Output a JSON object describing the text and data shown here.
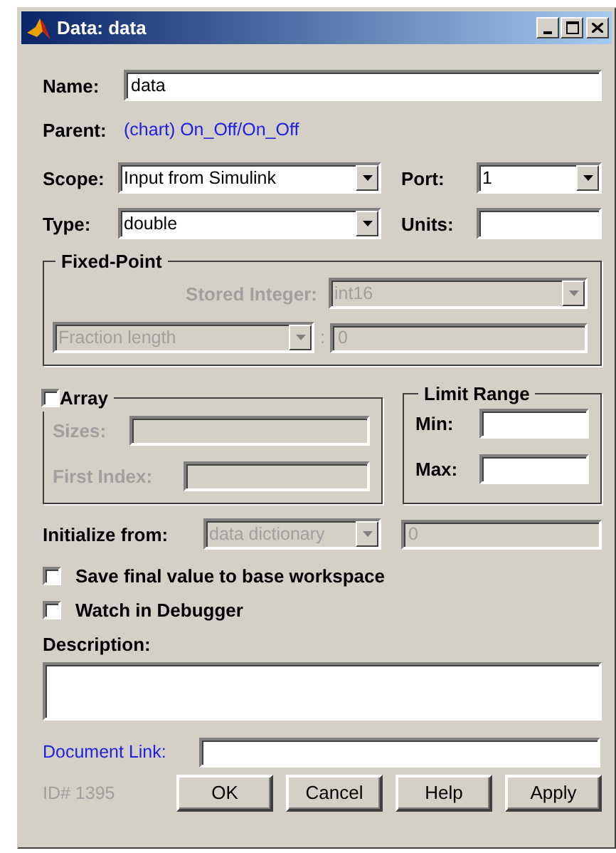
{
  "window": {
    "title": "Data: data"
  },
  "name": {
    "label": "Name:",
    "value": "data"
  },
  "parent": {
    "label": "Parent:",
    "value": "(chart) On_Off/On_Off"
  },
  "scope": {
    "label": "Scope:",
    "value": "Input from Simulink"
  },
  "port": {
    "label": "Port:",
    "value": "1"
  },
  "type": {
    "label": "Type:",
    "value": "double"
  },
  "units": {
    "label": "Units:"
  },
  "fixed_point": {
    "title": "Fixed-Point",
    "disabled": true,
    "stored_integer": {
      "label": "Stored Integer:",
      "value": "int16"
    },
    "fraction": {
      "value": "Fraction length",
      "separator": ":",
      "length": "0"
    }
  },
  "array": {
    "title": "Array",
    "checked": false,
    "sizes": {
      "label": "Sizes:"
    },
    "first_index": {
      "label": "First Index:"
    }
  },
  "limit_range": {
    "title": "Limit Range",
    "min": {
      "label": "Min:"
    },
    "max": {
      "label": "Max:"
    }
  },
  "initialize": {
    "label": "Initialize from:",
    "value": "data dictionary",
    "initial_value": "0",
    "disabled": true
  },
  "checkboxes": [
    {
      "label": "Save final value to base workspace",
      "checked": false
    },
    {
      "label": "Watch in Debugger",
      "checked": false
    }
  ],
  "description": {
    "label": "Description:"
  },
  "document_link": {
    "label": "Document Link:"
  },
  "id": "ID# 1395",
  "buttons": [
    "OK",
    "Cancel",
    "Help",
    "Apply"
  ]
}
